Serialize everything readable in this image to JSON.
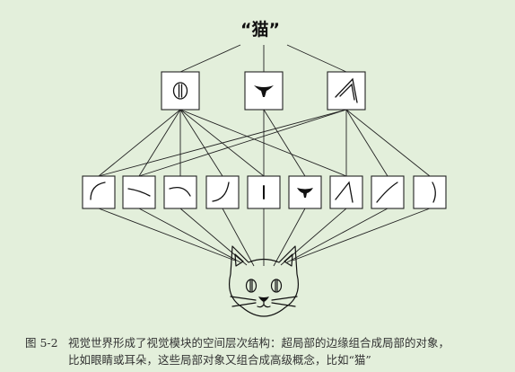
{
  "diagram": {
    "top_label": "“猫”",
    "levels": {
      "concept": "猫",
      "parts": [
        "eye-icon",
        "nose-icon",
        "ear-icon"
      ],
      "edges": [
        "edge-arc-left",
        "edge-curve-down",
        "edge-arc-top",
        "edge-curve-rise",
        "edge-vertical-bar",
        "edge-nose-shape",
        "edge-ear-corner",
        "edge-diagonal-curve",
        "edge-curve-right"
      ],
      "input": "cat-face-icon"
    }
  },
  "caption": {
    "figure_number": "图 5-2",
    "line1": "视觉世界形成了视觉模块的空间层次结构：超局部的边缘组合成局部的对象，",
    "line2": "比如眼睛或耳朵，这些局部对象又组合成高级概念，比如“猫”"
  }
}
